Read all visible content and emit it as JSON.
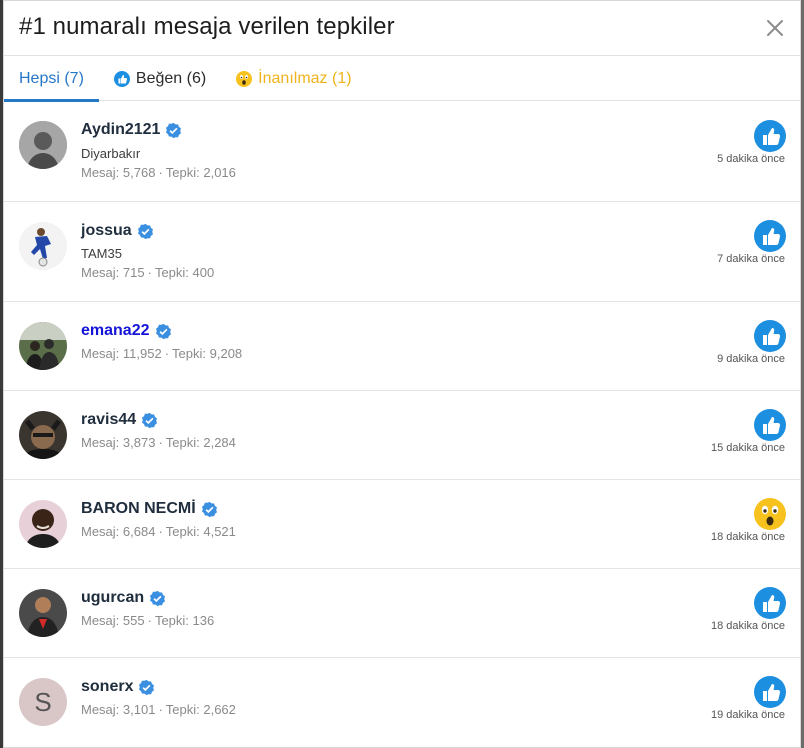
{
  "dialog": {
    "title": "#1 numaralı mesaja verilen tepkiler"
  },
  "tabs": [
    {
      "label": "Hepsi (7)",
      "icon": null
    },
    {
      "label": "Beğen (6)",
      "icon": "like-icon"
    },
    {
      "label": "İnanılmaz (1)",
      "icon": "wow-icon"
    }
  ],
  "colors": {
    "accent": "#2577c8",
    "like": "#1d8fe1",
    "wow": "#f7c21d",
    "verified": "#3a8fe0"
  },
  "reactions": [
    {
      "username": "Aydin2121",
      "title": "Diyarbakır",
      "mesaj_label": "Mesaj: 5,768",
      "tepki_label": "Tepki: 2,016",
      "time": "5 dakika önce",
      "reaction": "like-icon"
    },
    {
      "username": "jossua",
      "title": "TAM35",
      "mesaj_label": "Mesaj: 715",
      "tepki_label": "Tepki: 400",
      "time": "7 dakika önce",
      "reaction": "like-icon"
    },
    {
      "username": "emana22",
      "title": "",
      "mesaj_label": "Mesaj: 11,952",
      "tepki_label": "Tepki: 9,208",
      "time": "9 dakika önce",
      "reaction": "like-icon"
    },
    {
      "username": "ravis44",
      "title": "",
      "mesaj_label": "Mesaj: 3,873",
      "tepki_label": "Tepki: 2,284",
      "time": "15 dakika önce",
      "reaction": "like-icon"
    },
    {
      "username": "BARON NECMİ",
      "title": "",
      "mesaj_label": "Mesaj: 6,684",
      "tepki_label": "Tepki: 4,521",
      "time": "18 dakika önce",
      "reaction": "wow-icon"
    },
    {
      "username": "ugurcan",
      "title": "",
      "mesaj_label": "Mesaj: 555",
      "tepki_label": "Tepki: 136",
      "time": "18 dakika önce",
      "reaction": "like-icon"
    },
    {
      "username": "sonerx",
      "title": "",
      "mesaj_label": "Mesaj: 3,101",
      "tepki_label": "Tepki: 2,662",
      "time": "19 dakika önce",
      "reaction": "like-icon",
      "avatar_letter": "S"
    }
  ],
  "separator": "·"
}
